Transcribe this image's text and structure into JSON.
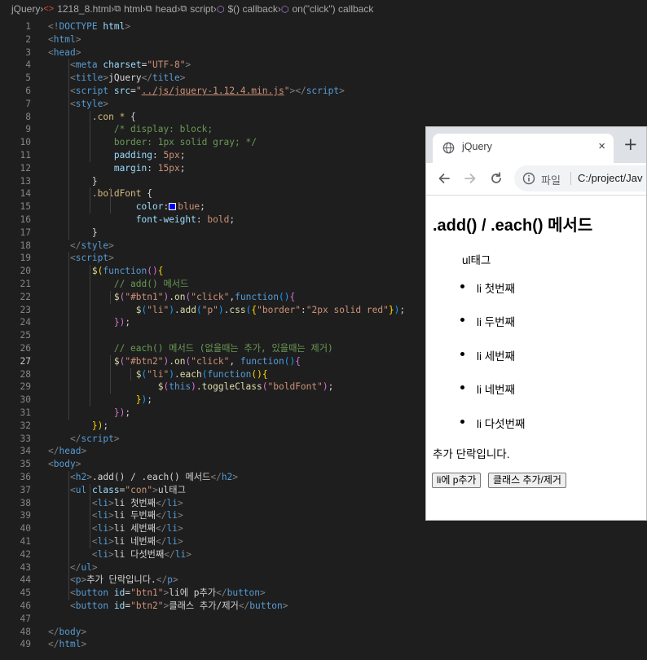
{
  "breadcrumb": {
    "items": [
      "jQuery",
      "1218_8.html",
      "html",
      "head",
      "script",
      "$() callback",
      "on(\"click\") callback"
    ]
  },
  "editor": {
    "active_line": 27,
    "line_numbers": [
      "1",
      "2",
      "3",
      "4",
      "5",
      "6",
      "7",
      "8",
      "9",
      "10",
      "11",
      "12",
      "13",
      "14",
      "15",
      "16",
      "17",
      "18",
      "19",
      "20",
      "21",
      "22",
      "23",
      "24",
      "25",
      "26",
      "27",
      "28",
      "29",
      "30",
      "31",
      "32",
      "33",
      "34",
      "35",
      "36",
      "37",
      "38",
      "39",
      "40",
      "41",
      "42",
      "43",
      "44",
      "45",
      "46",
      "47",
      "48",
      "49"
    ],
    "lines": [
      [
        [
          "br",
          "<!"
        ],
        [
          "tag",
          "DOCTYPE"
        ],
        [
          "txt",
          " "
        ],
        [
          "attr",
          "html"
        ],
        [
          "br",
          ">"
        ]
      ],
      [
        [
          "br",
          "<"
        ],
        [
          "tag",
          "html"
        ],
        [
          "br",
          ">"
        ]
      ],
      [
        [
          "br",
          "<"
        ],
        [
          "tag",
          "head"
        ],
        [
          "br",
          ">"
        ]
      ],
      [
        [
          "txt",
          "    "
        ],
        [
          "br",
          "<"
        ],
        [
          "tag",
          "meta"
        ],
        [
          "txt",
          " "
        ],
        [
          "attr",
          "charset"
        ],
        [
          "txt",
          "="
        ],
        [
          "str",
          "\"UTF-8\""
        ],
        [
          "br",
          ">"
        ]
      ],
      [
        [
          "txt",
          "    "
        ],
        [
          "br",
          "<"
        ],
        [
          "tag",
          "title"
        ],
        [
          "br",
          ">"
        ],
        [
          "txt",
          "jQuery"
        ],
        [
          "br",
          "</"
        ],
        [
          "tag",
          "title"
        ],
        [
          "br",
          ">"
        ]
      ],
      [
        [
          "txt",
          "    "
        ],
        [
          "br",
          "<"
        ],
        [
          "tag",
          "script"
        ],
        [
          "txt",
          " "
        ],
        [
          "attr",
          "src"
        ],
        [
          "txt",
          "="
        ],
        [
          "str",
          "\""
        ],
        [
          "link",
          "../js/jquery-1.12.4.min.js"
        ],
        [
          "str",
          "\""
        ],
        [
          "br",
          "></"
        ],
        [
          "tag",
          "script"
        ],
        [
          "br",
          ">"
        ]
      ],
      [
        [
          "txt",
          "    "
        ],
        [
          "br",
          "<"
        ],
        [
          "tag",
          "style"
        ],
        [
          "br",
          ">"
        ]
      ],
      [
        [
          "txt",
          "        "
        ],
        [
          "sel",
          ".con * "
        ],
        [
          "txt",
          "{"
        ]
      ],
      [
        [
          "txt",
          "            "
        ],
        [
          "com",
          "/* display: block;"
        ]
      ],
      [
        [
          "txt",
          "            "
        ],
        [
          "com",
          "border: 1px solid gray; */"
        ]
      ],
      [
        [
          "txt",
          "            "
        ],
        [
          "prop",
          "padding"
        ],
        [
          "txt",
          ": "
        ],
        [
          "val",
          "5px"
        ],
        [
          "txt",
          ";"
        ]
      ],
      [
        [
          "txt",
          "            "
        ],
        [
          "prop",
          "margin"
        ],
        [
          "txt",
          ": "
        ],
        [
          "val",
          "15px"
        ],
        [
          "txt",
          ";"
        ]
      ],
      [
        [
          "txt",
          "        }"
        ]
      ],
      [
        [
          "txt",
          "        "
        ],
        [
          "sel",
          ".boldFont "
        ],
        [
          "txt",
          "{"
        ]
      ],
      [
        [
          "txt",
          "                "
        ],
        [
          "prop",
          "color"
        ],
        [
          "txt",
          ":"
        ],
        [
          "swatch",
          ""
        ],
        [
          "val",
          "blue"
        ],
        [
          "txt",
          ";"
        ]
      ],
      [
        [
          "txt",
          "                "
        ],
        [
          "prop",
          "font-weight"
        ],
        [
          "txt",
          ": "
        ],
        [
          "val",
          "bold"
        ],
        [
          "txt",
          ";"
        ]
      ],
      [
        [
          "txt",
          "        }"
        ]
      ],
      [
        [
          "txt",
          "    "
        ],
        [
          "br",
          "</"
        ],
        [
          "tag",
          "style"
        ],
        [
          "br",
          ">"
        ]
      ],
      [
        [
          "txt",
          "    "
        ],
        [
          "br",
          "<"
        ],
        [
          "tag",
          "script"
        ],
        [
          "br",
          ">"
        ]
      ],
      [
        [
          "txt",
          "        "
        ],
        [
          "fn",
          "$"
        ],
        [
          "par",
          "("
        ],
        [
          "kw",
          "function"
        ],
        [
          "par2",
          "()"
        ],
        [
          "par",
          "{"
        ]
      ],
      [
        [
          "txt",
          "            "
        ],
        [
          "com",
          "// add() 메서드"
        ]
      ],
      [
        [
          "txt",
          "            "
        ],
        [
          "fn",
          "$"
        ],
        [
          "par2",
          "("
        ],
        [
          "str",
          "\"#btn1\""
        ],
        [
          "par2",
          ")"
        ],
        [
          "txt",
          "."
        ],
        [
          "fn",
          "on"
        ],
        [
          "par2",
          "("
        ],
        [
          "str",
          "\"click\""
        ],
        [
          "txt",
          ","
        ],
        [
          "kw",
          "function"
        ],
        [
          "par3",
          "()"
        ],
        [
          "par2",
          "{"
        ]
      ],
      [
        [
          "txt",
          "                "
        ],
        [
          "fn",
          "$"
        ],
        [
          "par3",
          "("
        ],
        [
          "str",
          "\"li\""
        ],
        [
          "par3",
          ")"
        ],
        [
          "txt",
          "."
        ],
        [
          "fn",
          "add"
        ],
        [
          "par3",
          "("
        ],
        [
          "str",
          "\"p\""
        ],
        [
          "par3",
          ")"
        ],
        [
          "txt",
          "."
        ],
        [
          "fn",
          "css"
        ],
        [
          "par3",
          "("
        ],
        [
          "par",
          "{"
        ],
        [
          "str",
          "\"border\""
        ],
        [
          "txt",
          ":"
        ],
        [
          "str",
          "\"2px solid red\""
        ],
        [
          "par",
          "}"
        ],
        [
          "par3",
          ")"
        ],
        [
          "txt",
          ";"
        ]
      ],
      [
        [
          "txt",
          "            "
        ],
        [
          "par2",
          "})"
        ],
        [
          "txt",
          ";"
        ]
      ],
      [
        [
          "txt",
          ""
        ]
      ],
      [
        [
          "txt",
          "            "
        ],
        [
          "com",
          "// each() 메서드 (없을때는 추가, 있을때는 제거)"
        ]
      ],
      [
        [
          "txt",
          "            "
        ],
        [
          "fn",
          "$"
        ],
        [
          "par2",
          "("
        ],
        [
          "str",
          "\"#btn2\""
        ],
        [
          "par2",
          ")"
        ],
        [
          "txt",
          "."
        ],
        [
          "fn",
          "on"
        ],
        [
          "par2",
          "("
        ],
        [
          "str",
          "\"click\""
        ],
        [
          "txt",
          ", "
        ],
        [
          "kw",
          "function"
        ],
        [
          "par3",
          "()"
        ],
        [
          "par2",
          "{"
        ]
      ],
      [
        [
          "txt",
          "                "
        ],
        [
          "fn",
          "$"
        ],
        [
          "par3",
          "("
        ],
        [
          "str",
          "\"li\""
        ],
        [
          "par3",
          ")"
        ],
        [
          "txt",
          "."
        ],
        [
          "fn",
          "each"
        ],
        [
          "par3",
          "("
        ],
        [
          "kw",
          "function"
        ],
        [
          "par",
          "()"
        ],
        [
          "par",
          "{"
        ]
      ],
      [
        [
          "txt",
          "                    "
        ],
        [
          "fn",
          "$"
        ],
        [
          "par2",
          "("
        ],
        [
          "kw",
          "this"
        ],
        [
          "par2",
          ")"
        ],
        [
          "txt",
          "."
        ],
        [
          "fn",
          "toggleClass"
        ],
        [
          "par2",
          "("
        ],
        [
          "str",
          "\"boldFont\""
        ],
        [
          "par2",
          ")"
        ],
        [
          "txt",
          ";"
        ]
      ],
      [
        [
          "txt",
          "                "
        ],
        [
          "par",
          "}"
        ],
        [
          "par3",
          ")"
        ],
        [
          "txt",
          ";"
        ]
      ],
      [
        [
          "txt",
          "            "
        ],
        [
          "par2",
          "})"
        ],
        [
          "txt",
          ";"
        ]
      ],
      [
        [
          "txt",
          "        "
        ],
        [
          "par",
          "})"
        ],
        [
          "txt",
          ";"
        ]
      ],
      [
        [
          "txt",
          "    "
        ],
        [
          "br",
          "</"
        ],
        [
          "tag",
          "script"
        ],
        [
          "br",
          ">"
        ]
      ],
      [
        [
          "br",
          "</"
        ],
        [
          "tag",
          "head"
        ],
        [
          "br",
          ">"
        ]
      ],
      [
        [
          "br",
          "<"
        ],
        [
          "tag",
          "body"
        ],
        [
          "br",
          ">"
        ]
      ],
      [
        [
          "txt",
          "    "
        ],
        [
          "br",
          "<"
        ],
        [
          "tag",
          "h2"
        ],
        [
          "br",
          ">"
        ],
        [
          "txt",
          ".add() / .each() 메서드"
        ],
        [
          "br",
          "</"
        ],
        [
          "tag",
          "h2"
        ],
        [
          "br",
          ">"
        ]
      ],
      [
        [
          "txt",
          "    "
        ],
        [
          "br",
          "<"
        ],
        [
          "tag",
          "ul"
        ],
        [
          "txt",
          " "
        ],
        [
          "attr",
          "class"
        ],
        [
          "txt",
          "="
        ],
        [
          "str",
          "\"con\""
        ],
        [
          "br",
          ">"
        ],
        [
          "txt",
          "ul태그"
        ]
      ],
      [
        [
          "txt",
          "        "
        ],
        [
          "br",
          "<"
        ],
        [
          "tag",
          "li"
        ],
        [
          "br",
          ">"
        ],
        [
          "txt",
          "li 첫번째"
        ],
        [
          "br",
          "</"
        ],
        [
          "tag",
          "li"
        ],
        [
          "br",
          ">"
        ]
      ],
      [
        [
          "txt",
          "        "
        ],
        [
          "br",
          "<"
        ],
        [
          "tag",
          "li"
        ],
        [
          "br",
          ">"
        ],
        [
          "txt",
          "li 두번째"
        ],
        [
          "br",
          "</"
        ],
        [
          "tag",
          "li"
        ],
        [
          "br",
          ">"
        ]
      ],
      [
        [
          "txt",
          "        "
        ],
        [
          "br",
          "<"
        ],
        [
          "tag",
          "li"
        ],
        [
          "br",
          ">"
        ],
        [
          "txt",
          "li 세번째"
        ],
        [
          "br",
          "</"
        ],
        [
          "tag",
          "li"
        ],
        [
          "br",
          ">"
        ]
      ],
      [
        [
          "txt",
          "        "
        ],
        [
          "br",
          "<"
        ],
        [
          "tag",
          "li"
        ],
        [
          "br",
          ">"
        ],
        [
          "txt",
          "li 네번째"
        ],
        [
          "br",
          "</"
        ],
        [
          "tag",
          "li"
        ],
        [
          "br",
          ">"
        ]
      ],
      [
        [
          "txt",
          "        "
        ],
        [
          "br",
          "<"
        ],
        [
          "tag",
          "li"
        ],
        [
          "br",
          ">"
        ],
        [
          "txt",
          "li 다섯번째"
        ],
        [
          "br",
          "</"
        ],
        [
          "tag",
          "li"
        ],
        [
          "br",
          ">"
        ]
      ],
      [
        [
          "txt",
          "    "
        ],
        [
          "br",
          "</"
        ],
        [
          "tag",
          "ul"
        ],
        [
          "br",
          ">"
        ]
      ],
      [
        [
          "txt",
          "    "
        ],
        [
          "br",
          "<"
        ],
        [
          "tag",
          "p"
        ],
        [
          "br",
          ">"
        ],
        [
          "txt",
          "추가 단락입니다."
        ],
        [
          "br",
          "</"
        ],
        [
          "tag",
          "p"
        ],
        [
          "br",
          ">"
        ]
      ],
      [
        [
          "txt",
          "    "
        ],
        [
          "br",
          "<"
        ],
        [
          "tag",
          "button"
        ],
        [
          "txt",
          " "
        ],
        [
          "attr",
          "id"
        ],
        [
          "txt",
          "="
        ],
        [
          "str",
          "\"btn1\""
        ],
        [
          "br",
          ">"
        ],
        [
          "txt",
          "li에 p추가"
        ],
        [
          "br",
          "</"
        ],
        [
          "tag",
          "button"
        ],
        [
          "br",
          ">"
        ]
      ],
      [
        [
          "txt",
          "    "
        ],
        [
          "br",
          "<"
        ],
        [
          "tag",
          "button"
        ],
        [
          "txt",
          " "
        ],
        [
          "attr",
          "id"
        ],
        [
          "txt",
          "="
        ],
        [
          "str",
          "\"btn2\""
        ],
        [
          "br",
          ">"
        ],
        [
          "txt",
          "클래스 추가/제거"
        ],
        [
          "br",
          "</"
        ],
        [
          "tag",
          "button"
        ],
        [
          "br",
          ">"
        ]
      ],
      [
        [
          "txt",
          ""
        ]
      ],
      [
        [
          "br",
          "</"
        ],
        [
          "tag",
          "body"
        ],
        [
          "br",
          ">"
        ]
      ],
      [
        [
          "br",
          "</"
        ],
        [
          "tag",
          "html"
        ],
        [
          "br",
          ">"
        ]
      ]
    ]
  },
  "browser": {
    "tab_title": "jQuery",
    "close_glyph": "×",
    "new_tab_glyph": "+",
    "address_label": "파일",
    "address_url": "C:/project/Jav",
    "page": {
      "heading": ".add() / .each() 메서드",
      "ul_label": "ul태그",
      "list_items": [
        "li 첫번째",
        "li 두번째",
        "li 세번째",
        "li 네번째",
        "li 다섯번째"
      ],
      "paragraph": "추가 단락입니다.",
      "button1": "li에 p추가",
      "button2": "클래스 추가/제거"
    }
  },
  "colors": {
    "editor_bg": "#1e1e1e",
    "tag": "#569cd6",
    "attribute": "#9cdcfe",
    "string": "#ce9178",
    "comment": "#6a9955",
    "function": "#dcdcaa",
    "selector": "#d7ba7d",
    "browser_tabstrip": "#dee1e6"
  }
}
